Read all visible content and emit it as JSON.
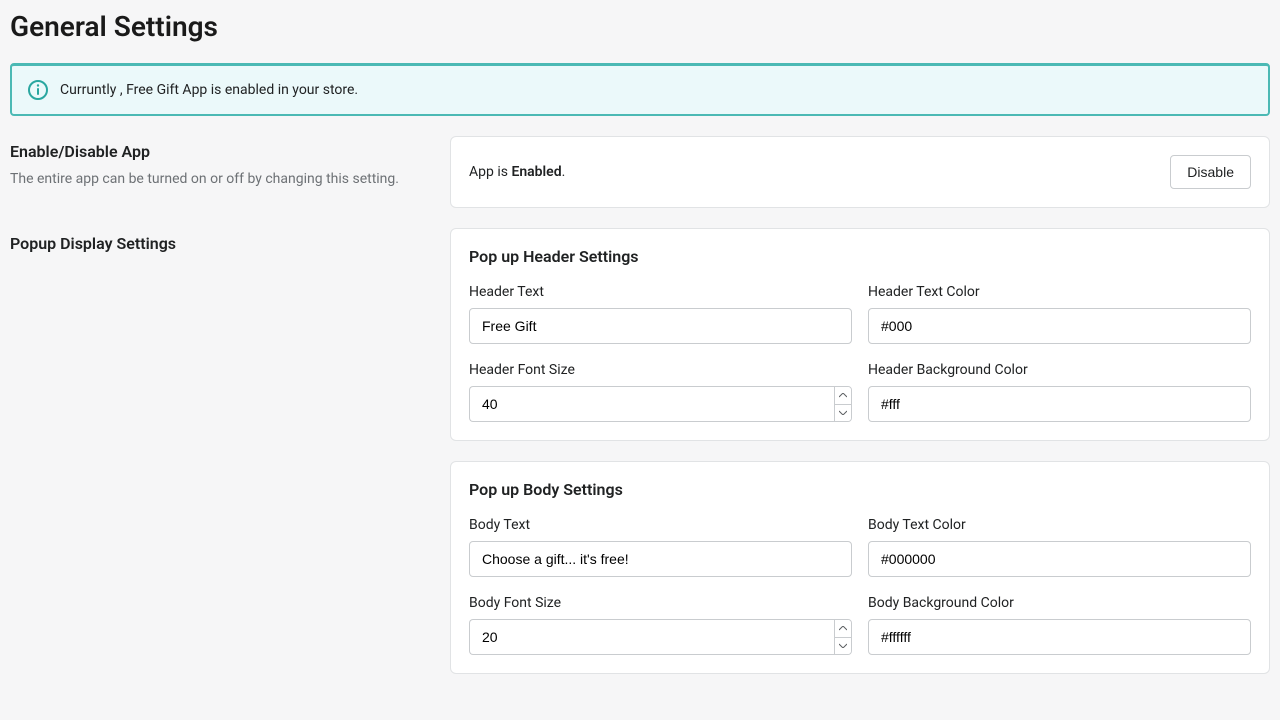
{
  "page": {
    "title": "General Settings"
  },
  "banner": {
    "message": "Curruntly , Free Gift App is enabled in your store."
  },
  "sections": {
    "enableDisable": {
      "title": "Enable/Disable App",
      "description": "The entire app can be turned on or off by changing this setting.",
      "status_prefix": "App is ",
      "status_value": "Enabled",
      "status_suffix": ".",
      "button_label": "Disable"
    },
    "popupDisplay": {
      "title": "Popup Display Settings"
    }
  },
  "popup_header": {
    "heading": "Pop up Header Settings",
    "fields": {
      "header_text": {
        "label": "Header Text",
        "value": "Free Gift"
      },
      "header_text_color": {
        "label": "Header Text Color",
        "value": "#000"
      },
      "header_font_size": {
        "label": "Header Font Size",
        "value": "40"
      },
      "header_bg_color": {
        "label": "Header Background Color",
        "value": "#fff"
      }
    }
  },
  "popup_body": {
    "heading": "Pop up Body Settings",
    "fields": {
      "body_text": {
        "label": "Body Text",
        "value": "Choose a gift... it's free!"
      },
      "body_text_color": {
        "label": "Body Text Color",
        "value": "#000000"
      },
      "body_font_size": {
        "label": "Body Font Size",
        "value": "20"
      },
      "body_bg_color": {
        "label": "Body Background Color",
        "value": "#ffffff"
      }
    }
  }
}
